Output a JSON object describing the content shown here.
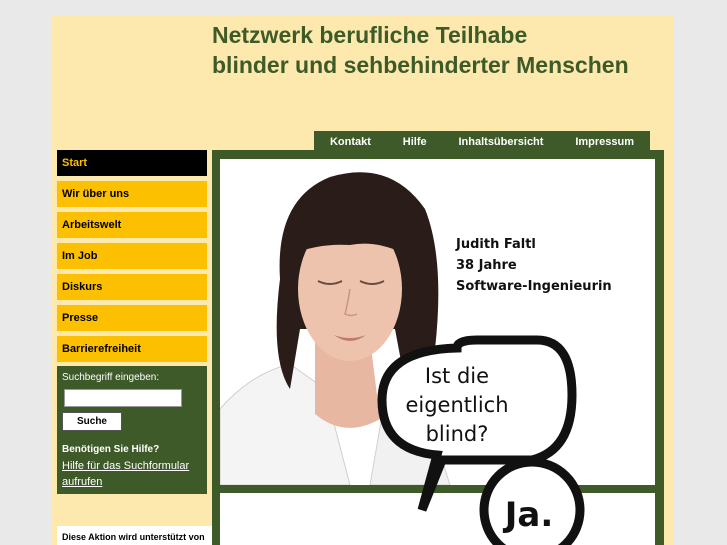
{
  "site": {
    "title_line1": "Netzwerk berufliche Teilhabe",
    "title_line2": "blinder und sehbehinderter Menschen"
  },
  "topnav": {
    "items": [
      {
        "label": "Kontakt"
      },
      {
        "label": "Hilfe"
      },
      {
        "label": "Inhaltsübersicht"
      },
      {
        "label": "Impressum"
      }
    ]
  },
  "sidenav": {
    "items": [
      {
        "label": "Start",
        "active": true
      },
      {
        "label": "Wir über uns"
      },
      {
        "label": "Arbeitswelt"
      },
      {
        "label": "Im Job"
      },
      {
        "label": "Diskurs"
      },
      {
        "label": "Presse"
      },
      {
        "label": "Barrierefreiheit"
      }
    ]
  },
  "search": {
    "label": "Suchbegriff eingeben:",
    "value": "",
    "button_label": "Suche",
    "help_heading": "Benötigen Sie Hilfe?",
    "help_link": "Hilfe für das Suchformular aufrufen"
  },
  "sponsor": {
    "text": "Diese Aktion wird unterstützt von"
  },
  "banner": {
    "caption_name": "Judith Faltl",
    "caption_age": "38 Jahre",
    "caption_job": "Software-Ingenieurin",
    "bubble_line1": "Ist die",
    "bubble_line2": "eigentlich",
    "bubble_line3": "blind?",
    "answer": "Ja."
  },
  "colors": {
    "page_bg": "#fde9ae",
    "brand_green": "#3d5a28",
    "nav_yellow": "#fcc000",
    "nav_active_bg": "#000000"
  }
}
